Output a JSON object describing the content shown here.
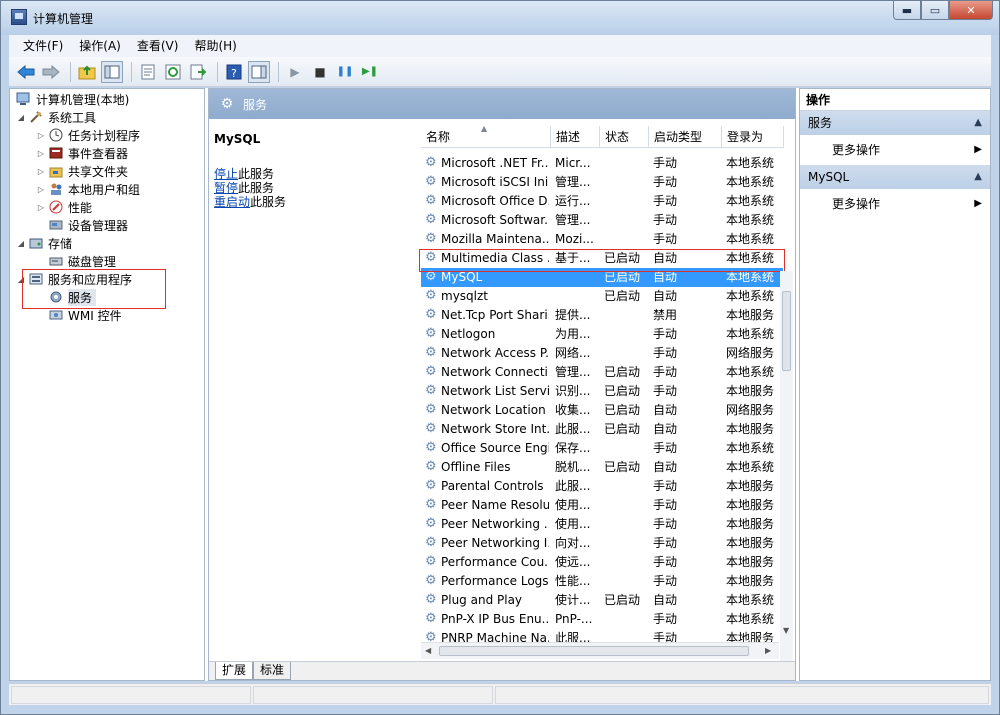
{
  "window": {
    "title": "计算机管理",
    "min": "▬",
    "max": "▭",
    "close": "✕"
  },
  "menu": [
    "文件(F)",
    "操作(A)",
    "查看(V)",
    "帮助(H)"
  ],
  "toolbar": {
    "back_icon": "back-arrow",
    "forward_icon": "forward-arrow",
    "play": "▶",
    "stop": "■",
    "pause": "❚❚",
    "restart": "▶❚"
  },
  "tree": {
    "root": "计算机管理(本地)",
    "items": [
      {
        "label": "系统工具",
        "level": 1,
        "expander": "◢",
        "icon": "tools-icon"
      },
      {
        "label": "任务计划程序",
        "level": 2,
        "expander": "▷",
        "icon": "clock-icon"
      },
      {
        "label": "事件查看器",
        "level": 2,
        "expander": "▷",
        "icon": "event-viewer-icon"
      },
      {
        "label": "共享文件夹",
        "level": 2,
        "expander": "▷",
        "icon": "shared-folder-icon"
      },
      {
        "label": "本地用户和组",
        "level": 2,
        "expander": "▷",
        "icon": "users-icon"
      },
      {
        "label": "性能",
        "level": 2,
        "expander": "▷",
        "icon": "performance-icon"
      },
      {
        "label": "设备管理器",
        "level": 2,
        "expander": "",
        "icon": "device-manager-icon"
      },
      {
        "label": "存储",
        "level": 1,
        "expander": "◢",
        "icon": "storage-icon"
      },
      {
        "label": "磁盘管理",
        "level": 2,
        "expander": "",
        "icon": "disk-icon"
      },
      {
        "label": "服务和应用程序",
        "level": 1,
        "expander": "◢",
        "icon": "services-apps-icon"
      },
      {
        "label": "服务",
        "level": 2,
        "expander": "",
        "icon": "gear-icon"
      },
      {
        "label": "WMI 控件",
        "level": 2,
        "expander": "",
        "icon": "wmi-icon"
      }
    ]
  },
  "center": {
    "header": "服务",
    "selected_service": "MySQL",
    "actions": [
      {
        "link": "停止",
        "text": "此服务"
      },
      {
        "link": "暂停",
        "text": "此服务"
      },
      {
        "link": "重启动",
        "text": "此服务"
      }
    ],
    "columns": [
      "名称",
      "描述",
      "状态",
      "启动类型",
      "登录为"
    ],
    "rows": [
      [
        "Microsoft .NET Fr...",
        "Micr...",
        "",
        "手动",
        "本地系统"
      ],
      [
        "Microsoft iSCSI Ini...",
        "管理...",
        "",
        "手动",
        "本地系统"
      ],
      [
        "Microsoft Office D...",
        "运行...",
        "",
        "手动",
        "本地系统"
      ],
      [
        "Microsoft Softwar...",
        "管理...",
        "",
        "手动",
        "本地系统"
      ],
      [
        "Mozilla Maintena...",
        "Mozi...",
        "",
        "手动",
        "本地系统"
      ],
      [
        "Multimedia Class ...",
        "基于...",
        "已启动",
        "自动",
        "本地系统"
      ],
      [
        "MySQL",
        "",
        "已启动",
        "自动",
        "本地系统"
      ],
      [
        "mysqlzt",
        "",
        "已启动",
        "自动",
        "本地系统"
      ],
      [
        "Net.Tcp Port Shari...",
        "提供...",
        "",
        "禁用",
        "本地服务"
      ],
      [
        "Netlogon",
        "为用...",
        "",
        "手动",
        "本地系统"
      ],
      [
        "Network Access P...",
        "网络...",
        "",
        "手动",
        "网络服务"
      ],
      [
        "Network Connecti...",
        "管理...",
        "已启动",
        "手动",
        "本地系统"
      ],
      [
        "Network List Service",
        "识别...",
        "已启动",
        "手动",
        "本地服务"
      ],
      [
        "Network Location ...",
        "收集...",
        "已启动",
        "自动",
        "网络服务"
      ],
      [
        "Network Store Int...",
        "此服...",
        "已启动",
        "自动",
        "本地服务"
      ],
      [
        "Office Source Engi...",
        "保存...",
        "",
        "手动",
        "本地系统"
      ],
      [
        "Offline Files",
        "脱机...",
        "已启动",
        "自动",
        "本地系统"
      ],
      [
        "Parental Controls",
        "此服...",
        "",
        "手动",
        "本地服务"
      ],
      [
        "Peer Name Resolu...",
        "使用...",
        "",
        "手动",
        "本地服务"
      ],
      [
        "Peer Networking ...",
        "使用...",
        "",
        "手动",
        "本地服务"
      ],
      [
        "Peer Networking I...",
        "向对...",
        "",
        "手动",
        "本地服务"
      ],
      [
        "Performance Cou...",
        "使远...",
        "",
        "手动",
        "本地服务"
      ],
      [
        "Performance Logs...",
        "性能...",
        "",
        "手动",
        "本地服务"
      ],
      [
        "Plug and Play",
        "使计...",
        "已启动",
        "自动",
        "本地系统"
      ],
      [
        "PnP-X IP Bus Enu...",
        "PnP-...",
        "",
        "手动",
        "本地系统"
      ],
      [
        "PNRP Machine Na...",
        "此服...",
        "",
        "手动",
        "本地服务"
      ]
    ],
    "tabs": [
      "扩展",
      "标准"
    ]
  },
  "actions_pane": {
    "title": "操作",
    "sections": [
      {
        "label": "服务",
        "item": "更多操作"
      },
      {
        "label": "MySQL",
        "item": "更多操作"
      }
    ]
  },
  "colors": {
    "selection": "#3399ff",
    "highlight_box": "#e0302a",
    "pane_header": "#9fb8d6"
  }
}
